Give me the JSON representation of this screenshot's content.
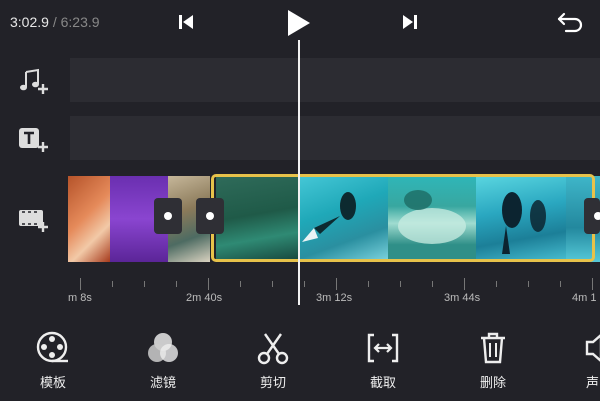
{
  "player": {
    "current_time": "3:02.9",
    "separator": " / ",
    "total_time": "6:23.9"
  },
  "tracks": {
    "music_add_icon": "music-add-icon",
    "text_add_icon": "text-add-icon",
    "video_add_icon": "video-add-icon"
  },
  "timeline": {
    "ticks": [
      "m 8s",
      "2m 40s",
      "3m 12s",
      "3m 44s",
      "4m 1"
    ]
  },
  "toolbar": {
    "items": [
      {
        "label": "模板",
        "icon": "film-reel-icon"
      },
      {
        "label": "滤镜",
        "icon": "filter-circles-icon"
      },
      {
        "label": "剪切",
        "icon": "scissors-icon"
      },
      {
        "label": "截取",
        "icon": "trim-icon"
      },
      {
        "label": "删除",
        "icon": "trash-icon"
      },
      {
        "label": "声",
        "icon": "sound-icon"
      }
    ]
  },
  "colors": {
    "background": "#222228",
    "track": "#2c2c32",
    "selection": "#e7c24a",
    "playhead": "#f2f2f2"
  }
}
